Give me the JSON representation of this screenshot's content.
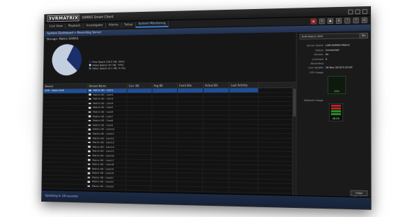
{
  "app": {
    "logo": "3VR",
    "logo_tail": "MATRIX",
    "title": "SAMAS Smart Client"
  },
  "tabs": [
    {
      "label": "Live View"
    },
    {
      "label": "Playback"
    },
    {
      "label": "Investigator"
    },
    {
      "label": "Alarms"
    },
    {
      "label": "Setup"
    },
    {
      "label": "System Monitoring"
    }
  ],
  "toolbar_icons": [
    "grid-icon",
    "refresh-icon",
    "record-icon",
    "settings-icon",
    "alert-icon",
    "help-icon",
    "user-icon"
  ],
  "breadcrumb": "System Dashboard > Recording Server",
  "storage": {
    "label": "Storage: Matrix-SAMAS",
    "legend": [
      {
        "text": "Free Space (28.5 GB, 30%)",
        "color": "#1a2f6b"
      },
      {
        "text": "Video Space (41 GB, 70%)",
        "color": "#c3cee0"
      },
      {
        "text": "Other Space (0.1 GB, 0.1%)",
        "color": "#4a6ea8"
      }
    ],
    "pie_values": [
      30,
      69.9,
      0.1
    ]
  },
  "table": {
    "headers": [
      "Source",
      "Stream Name",
      "Curr. Bit",
      "Avg Bit",
      "Cond Bits",
      "Actual Bit",
      "Last Activity"
    ],
    "source_row": "NVR - Matrix NVR",
    "cameras": [
      "Matrix HD - Cam1",
      "Matrix HD - Cam2",
      "Matrix HD - Cam3",
      "Matrix HD - Cam4",
      "Matrix HD - Cam5",
      "Matrix HD - Cam6",
      "Matrix HD - Cam7",
      "Matrix HD - Cam8",
      "Matrix HD - Cam9",
      "Matrix HD - Cam10",
      "Matrix HD - Cam11",
      "Matrix HD - Cam12",
      "Matrix HD - Cam13",
      "Matrix HD - Cam14",
      "Matrix HD - Cam15",
      "Matrix HD - Cam16",
      "Matrix HD - Cam17",
      "Matrix HD - Cam18",
      "Matrix HD - Cam19",
      "Matrix HD - Cam20",
      "Matrix HD - Cam21",
      "Matrix HD - Cam22",
      "Matrix HD - Cam23"
    ]
  },
  "side": {
    "dropdown": "NVR-Matrix NVR",
    "button": "Go",
    "fields": [
      {
        "k": "Server Name",
        "v": "LAM-SAMAS-Matrix"
      },
      {
        "k": "Status",
        "v": "Connected"
      },
      {
        "k": "Version",
        "v": "4x"
      },
      {
        "k": "Licensed Recording",
        "v": "4"
      },
      {
        "k": "Live Update",
        "v": "28 Nov 2016 9:33:00"
      }
    ],
    "cpu_label": "CPU Usage",
    "cpu_value": "22%",
    "net_label": "Network Usage",
    "net_value": "48.2%",
    "close_button": "Close Monitor"
  },
  "status": "Updating in 18 seconds"
}
